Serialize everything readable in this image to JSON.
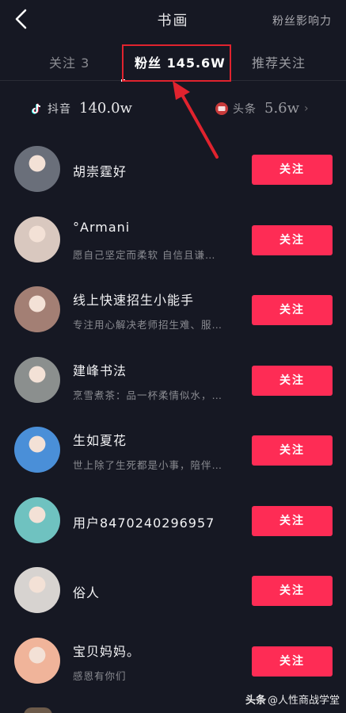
{
  "header": {
    "title": "书画",
    "influence_label": "粉丝影响力"
  },
  "tabs": [
    {
      "label": "关注 3"
    },
    {
      "label": "粉丝 145.6W"
    },
    {
      "label": "推荐关注"
    }
  ],
  "sources": {
    "douyin": {
      "name": "抖音",
      "count": "140.0w"
    },
    "toutiao": {
      "name": "头条",
      "count": "5.6w",
      "chevron": "›"
    }
  },
  "followers": [
    {
      "name": "胡崇霆好",
      "desc": "",
      "avatar_color": "#6a6f7a"
    },
    {
      "name": "°Armani",
      "desc": "愿自己坚定而柔软 自信且谦…",
      "avatar_color": "#d9c8bf"
    },
    {
      "name": "线上快速招生小能手",
      "desc": "专注用心解决老师招生难、服…",
      "avatar_color": "#a37f74"
    },
    {
      "name": "建峰书法",
      "desc": "烹雪煮茶：品一杯柔情似水，…",
      "avatar_color": "#8b8f8e"
    },
    {
      "name": "生如夏花",
      "desc": "世上除了生死都是小事，陪伴…",
      "avatar_color": "#4a8fd8"
    },
    {
      "name": "用户8470240296957",
      "desc": "",
      "avatar_color": "#6fc2c0"
    },
    {
      "name": "俗人",
      "desc": "",
      "avatar_color": "#d7d3d0"
    },
    {
      "name": "宝贝妈妈。",
      "desc": "感恩有你们",
      "avatar_color": "#f0b49a"
    }
  ],
  "follow_label": "关注",
  "watermark": {
    "brand": "头条",
    "text": "@人性商战学堂"
  },
  "colors": {
    "background": "#161823",
    "accent": "#fe2c55",
    "annotation": "#e0232e"
  }
}
